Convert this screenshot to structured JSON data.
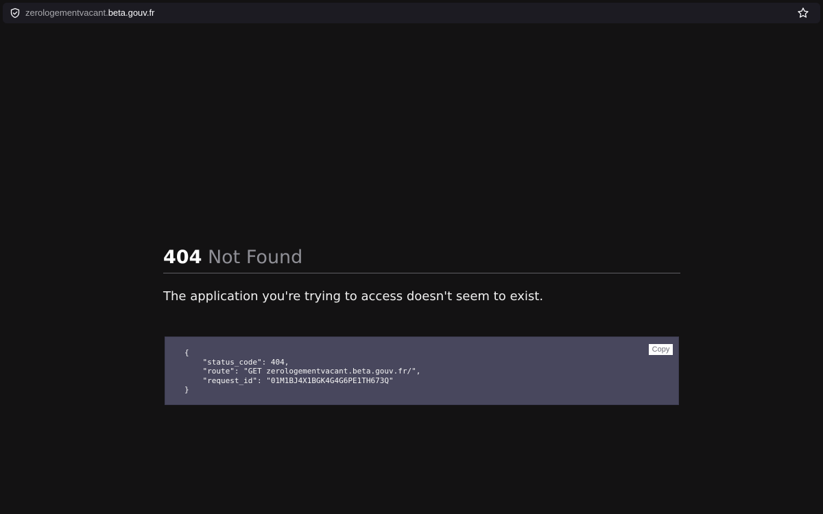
{
  "browser": {
    "url_subdomain": "zerologementvacant.",
    "url_domain": "beta.gouv.fr",
    "shield_icon": "shield-check-icon",
    "star_icon": "star-outline-icon"
  },
  "error": {
    "code": "404",
    "status_text": "Not Found",
    "message": "The application you're trying to access doesn't seem to exist."
  },
  "details": {
    "json_text": "{\n    \"status_code\": 404,\n    \"route\": \"GET zerologementvacant.beta.gouv.fr/\",\n    \"request_id\": \"01M1BJ4X1BGK4G4G6PE1TH673Q\"\n}",
    "copy_label": "Copy"
  },
  "colors": {
    "background": "#131213",
    "code_block": "#48475d"
  }
}
